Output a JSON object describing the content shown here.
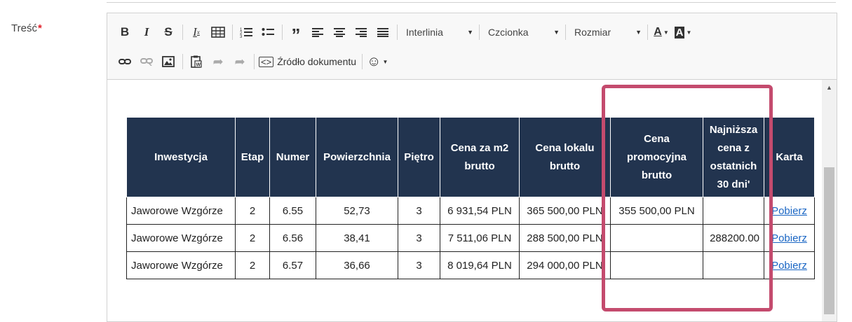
{
  "field": {
    "label": "Treść",
    "required_mark": "*"
  },
  "toolbar": {
    "interlinia": "Interlinia",
    "czcionka": "Czcionka",
    "rozmiar": "Rozmiar",
    "source": "Źródło dokumentu"
  },
  "table": {
    "headers": [
      "Inwestycja",
      "Etap",
      "Numer",
      "Powierzchnia",
      "Piętro",
      "Cena za m2 brutto",
      "Cena lokalu brutto",
      "Cena promocyjna brutto",
      "Najniższa cena z ostatnich 30 dni'",
      "Karta"
    ],
    "rows": [
      [
        "Jaworowe Wzgórze",
        "2",
        "6.55",
        "52,73",
        "3",
        "6 931,54 PLN",
        "365 500,00 PLN",
        "355 500,00 PLN",
        "",
        "Pobierz"
      ],
      [
        "Jaworowe Wzgórze",
        "2",
        "6.56",
        "38,41",
        "3",
        "7 511,06 PLN",
        "288 500,00 PLN",
        "",
        "288200.00",
        "Pobierz"
      ],
      [
        "Jaworowe Wzgórze",
        "2",
        "6.57",
        "36,66",
        "3",
        "8 019,64 PLN",
        "294 000,00 PLN",
        "",
        "",
        "Pobierz"
      ]
    ]
  },
  "colors": {
    "header_bg": "#22344f",
    "highlight": "#c44b6e",
    "link": "#1a66c4"
  }
}
